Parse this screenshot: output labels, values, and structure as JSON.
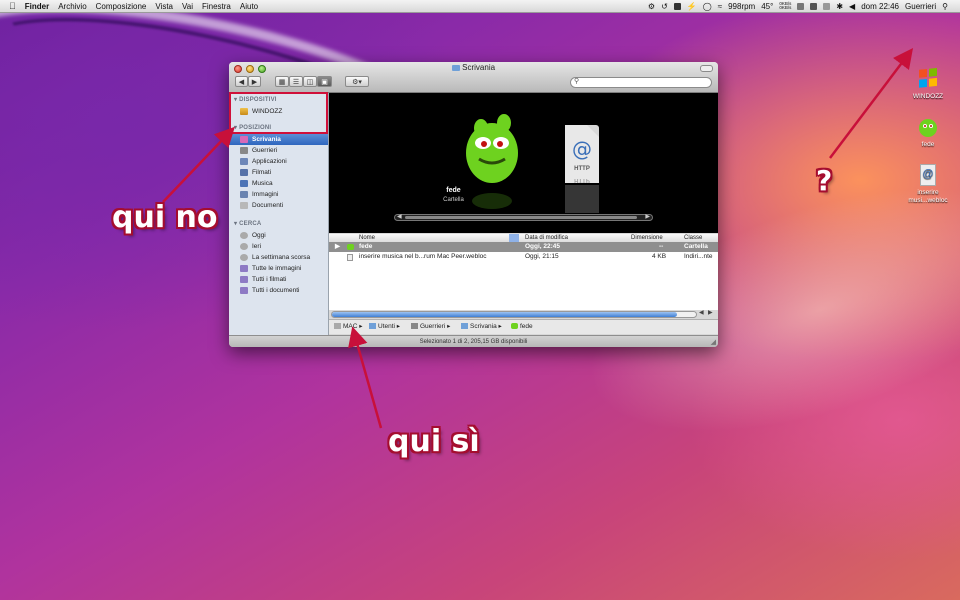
{
  "menubar": {
    "apple": "",
    "app": "Finder",
    "menus": [
      "Archivio",
      "Composizione",
      "Vista",
      "Vai",
      "Finestra",
      "Aiuto"
    ],
    "fan": "998rpm",
    "temp": "45°",
    "net_up": "0KB/s",
    "net_down": "0KB/s",
    "clock": "dom 22:46",
    "user": "Guerrieri"
  },
  "window": {
    "title": "Scrivania",
    "sidebar": {
      "devices_header": "DISPOSITIVI",
      "devices": [
        {
          "label": "WINDOZZ"
        }
      ],
      "places_header": "POSIZIONI",
      "places": [
        {
          "label": "Scrivania",
          "selected": true
        },
        {
          "label": "Guerrieri"
        },
        {
          "label": "Applicazioni"
        },
        {
          "label": "Filmati"
        },
        {
          "label": "Musica"
        },
        {
          "label": "Immagini"
        },
        {
          "label": "Documenti"
        }
      ],
      "search_header": "CERCA",
      "searches": [
        {
          "label": "Oggi"
        },
        {
          "label": "Ieri"
        },
        {
          "label": "La settimana scorsa"
        },
        {
          "label": "Tutte le immagini"
        },
        {
          "label": "Tutti i filmati"
        },
        {
          "label": "Tutti i documenti"
        }
      ]
    },
    "coverflow": {
      "item_name": "fede",
      "item_kind": "Cartella",
      "http_label": "HTTP",
      "http_label2": "HTTP"
    },
    "columns": {
      "name": "Nome",
      "date": "Data di modifica",
      "size": "Dimensione",
      "kind": "Classe"
    },
    "rows": [
      {
        "name": "fede",
        "date": "Oggi, 22:45",
        "size": "--",
        "kind": "Cartella",
        "selected": true
      },
      {
        "name": "inserire musica nel b...rum Mac Peer.webloc",
        "date": "Oggi, 21:15",
        "size": "4 KB",
        "kind": "Indiri...nte"
      }
    ],
    "path": [
      "MAC",
      "Utenti",
      "Guerrieri",
      "Scrivania",
      "fede"
    ],
    "status": "Selezionato 1 di 2, 205,15 GB disponibili"
  },
  "desktop": {
    "icons": [
      {
        "label": "WINDOZZ"
      },
      {
        "label": "fede"
      },
      {
        "label": "inserire musi...webloc",
        "glyph": "@"
      }
    ]
  },
  "annotations": {
    "qui_no": "qui no",
    "qui_si": "qui sì",
    "question": "?"
  },
  "colors": {
    "annotation_red": "#d0103a",
    "selection_blue": "#3a6fc4"
  }
}
